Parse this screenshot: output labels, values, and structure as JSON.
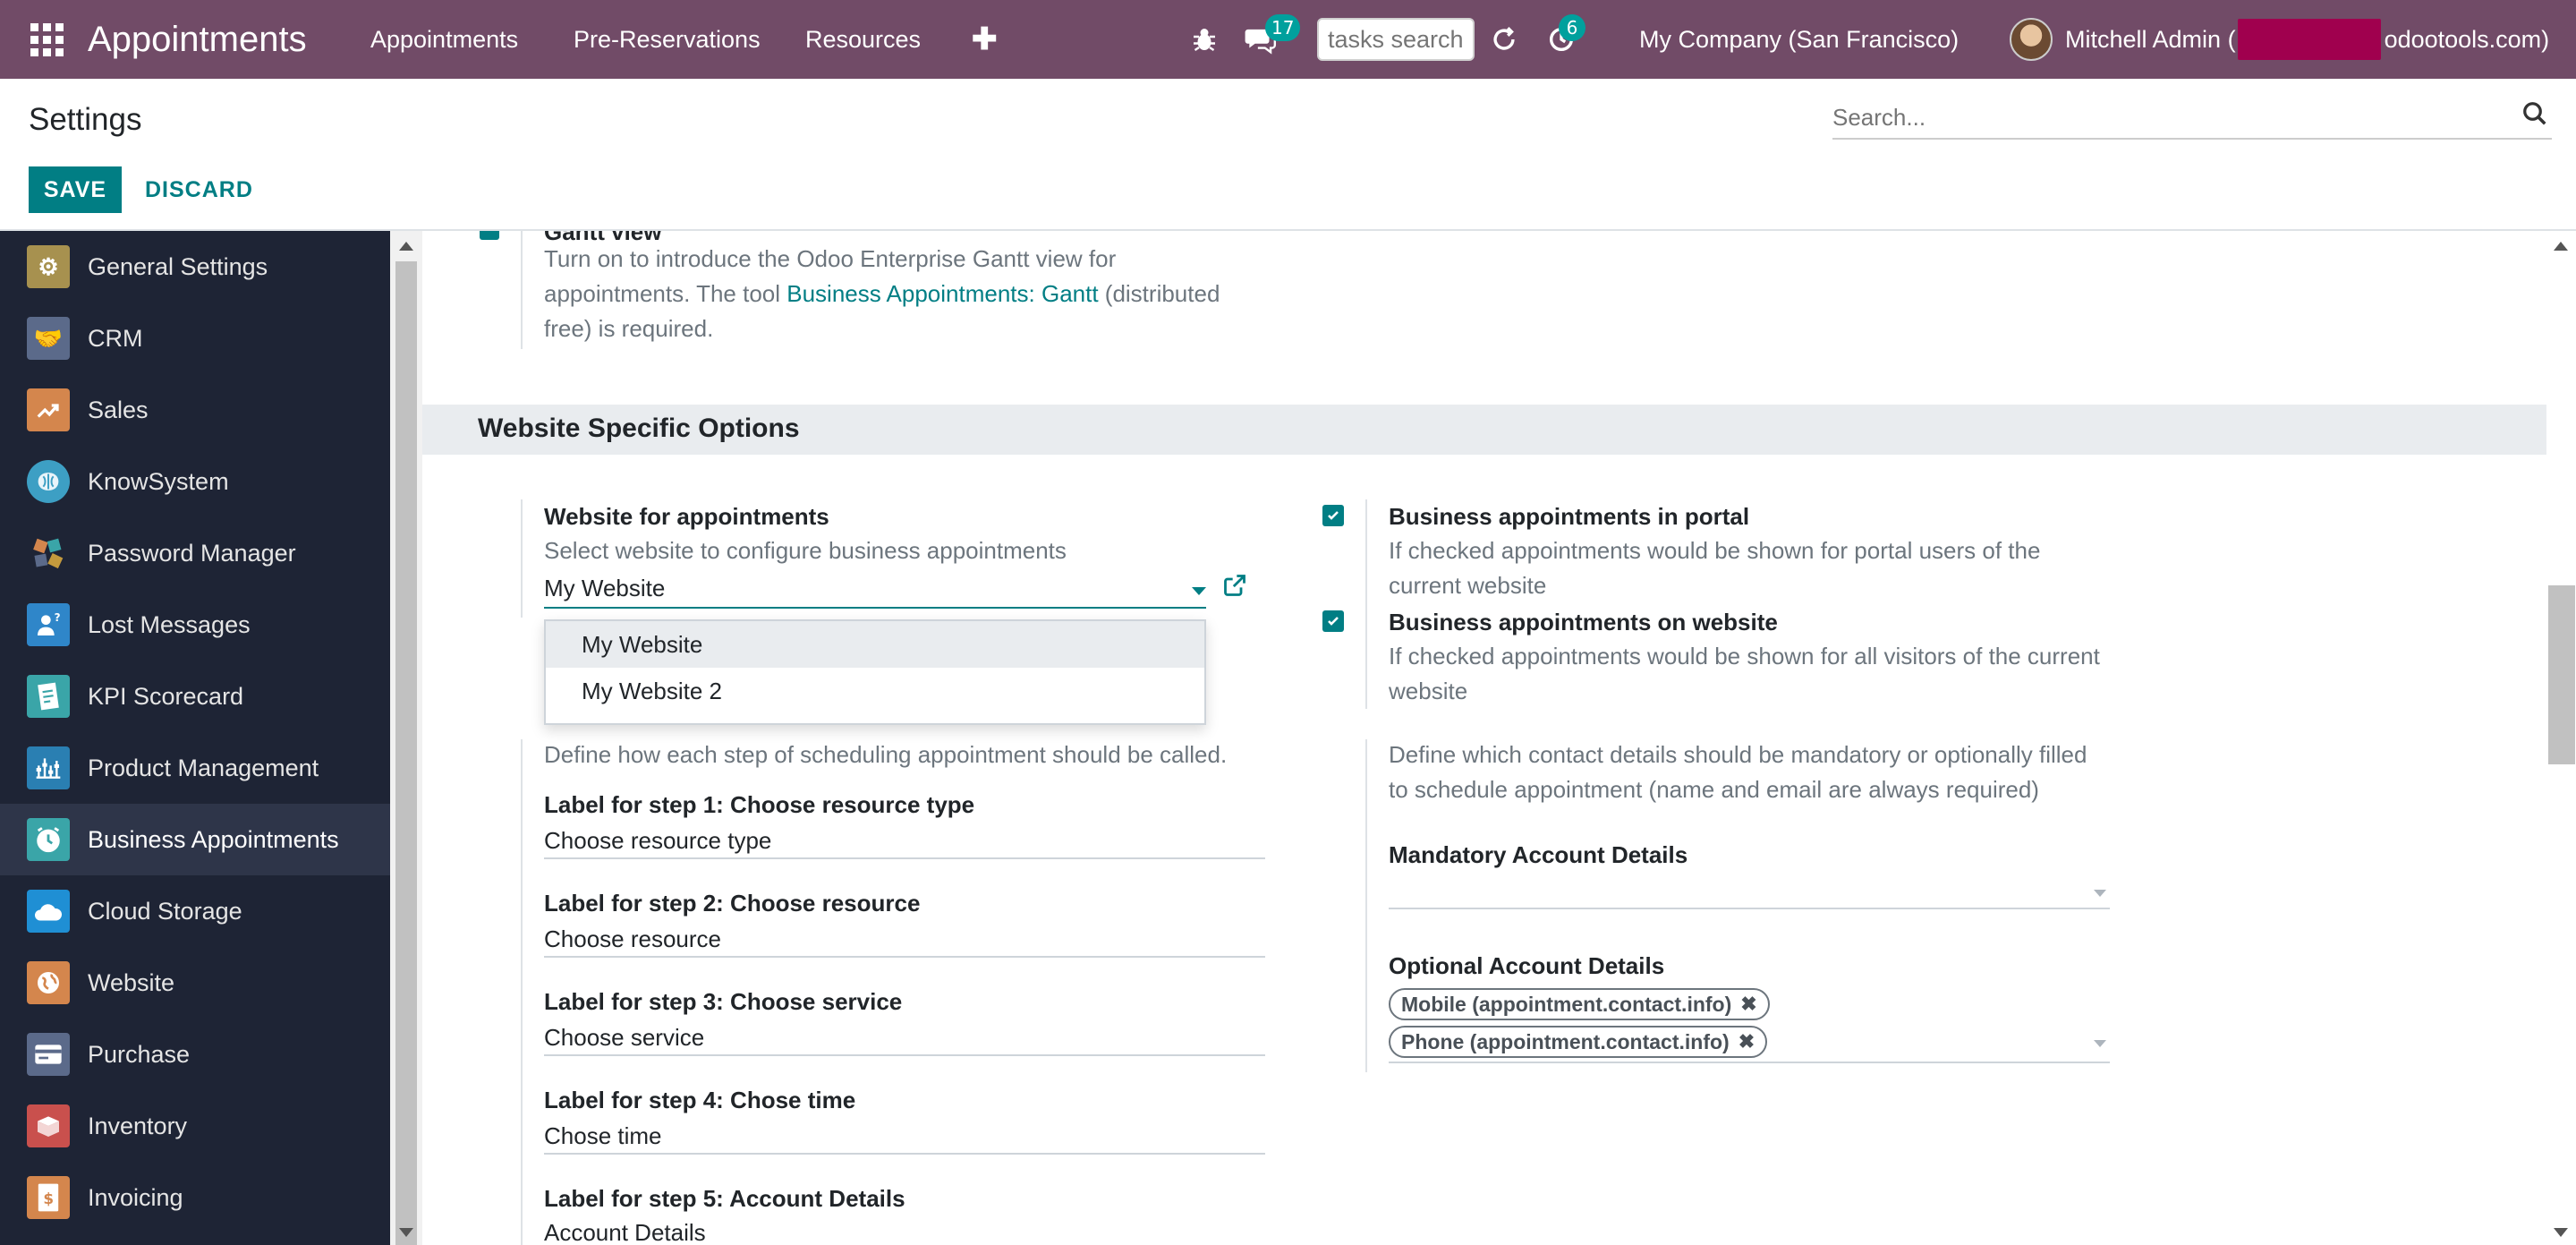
{
  "navbar": {
    "brand": "Appointments",
    "menu": [
      "Appointments",
      "Pre-Reservations",
      "Resources"
    ],
    "plus": "✚",
    "chat_count": "17",
    "activity_count": "6",
    "task_search_placeholder": "tasks search",
    "company": "My Company (San Francisco)",
    "user_prefix": "Mitchell Admin (",
    "user_suffix": "odootools.com)"
  },
  "control_panel": {
    "title": "Settings",
    "save_label": "SAVE",
    "discard_label": "DISCARD",
    "search_placeholder": "Search..."
  },
  "sidebar": {
    "items": [
      {
        "label": "General Settings",
        "icon": "gear-icon",
        "color": "#a7914f"
      },
      {
        "label": "CRM",
        "icon": "handshake-icon",
        "color": "#5b6a8a"
      },
      {
        "label": "Sales",
        "icon": "chart-up-icon",
        "color": "#d4864d"
      },
      {
        "label": "KnowSystem",
        "icon": "brain-icon",
        "color": "#3d9fc4"
      },
      {
        "label": "Password Manager",
        "icon": "key-icon",
        "color": "#c49a3d"
      },
      {
        "label": "Lost Messages",
        "icon": "person-question-icon",
        "color": "#2f86c9"
      },
      {
        "label": "KPI Scorecard",
        "icon": "scorecard-icon",
        "color": "#3aa5a8"
      },
      {
        "label": "Product Management",
        "icon": "sliders-icon",
        "color": "#2a7fb2"
      },
      {
        "label": "Business Appointments",
        "icon": "clock-icon",
        "color": "#3aa5a8"
      },
      {
        "label": "Cloud Storage",
        "icon": "cloud-icon",
        "color": "#1f8fd4"
      },
      {
        "label": "Website",
        "icon": "globe-icon",
        "color": "#d4864d"
      },
      {
        "label": "Purchase",
        "icon": "credit-card-icon",
        "color": "#5b6a8a"
      },
      {
        "label": "Inventory",
        "icon": "box-icon",
        "color": "#c9504d"
      },
      {
        "label": "Invoicing",
        "icon": "invoice-icon",
        "color": "#d4864d"
      }
    ],
    "active_index": 8
  },
  "content": {
    "gantt_title_partial": "Gantt view",
    "gantt_desc_1": "Turn on to introduce the Odoo Enterprise Gantt view for",
    "gantt_desc_2_prefix": "appointments. The tool ",
    "gantt_desc_2_link": "Business Appointments: Gantt",
    "gantt_desc_2_suffix": " (distributed",
    "gantt_desc_3": "free) is required.",
    "section_title": "Website Specific Options",
    "website_label": "Website for appointments",
    "website_desc": "Select website to configure business appointments",
    "website_value": "My Website",
    "website_options": [
      "My Website",
      "My Website 2"
    ],
    "portal_label": "Business appointments in portal",
    "portal_desc_1": "If checked appointments would be shown for portal users of the",
    "portal_desc_2": "current website",
    "portal_checked": true,
    "web_label": "Business appointments on website",
    "web_desc_1": "If checked appointments would be shown for all visitors of the current",
    "web_desc_2": "website",
    "web_checked": true,
    "steps_desc": "Define how each step of scheduling appointment should be called.",
    "steps": [
      {
        "label": "Label for step 1: Choose resource type",
        "value": "Choose resource type"
      },
      {
        "label": "Label for step 2: Choose resource",
        "value": "Choose resource"
      },
      {
        "label": "Label for step 3: Choose service",
        "value": "Choose service"
      },
      {
        "label": "Label for step 4: Chose time",
        "value": "Chose time"
      },
      {
        "label": "Label for step 5: Account Details",
        "value": "Account Details"
      }
    ],
    "contact_desc_1": "Define which contact details should be mandatory or optionally filled",
    "contact_desc_2": "to schedule appointment (name and email are always required)",
    "mandatory_label": "Mandatory Account Details",
    "optional_label": "Optional Account Details",
    "optional_tags": [
      "Mobile (appointment.contact.info)",
      "Phone (appointment.contact.info)"
    ]
  }
}
